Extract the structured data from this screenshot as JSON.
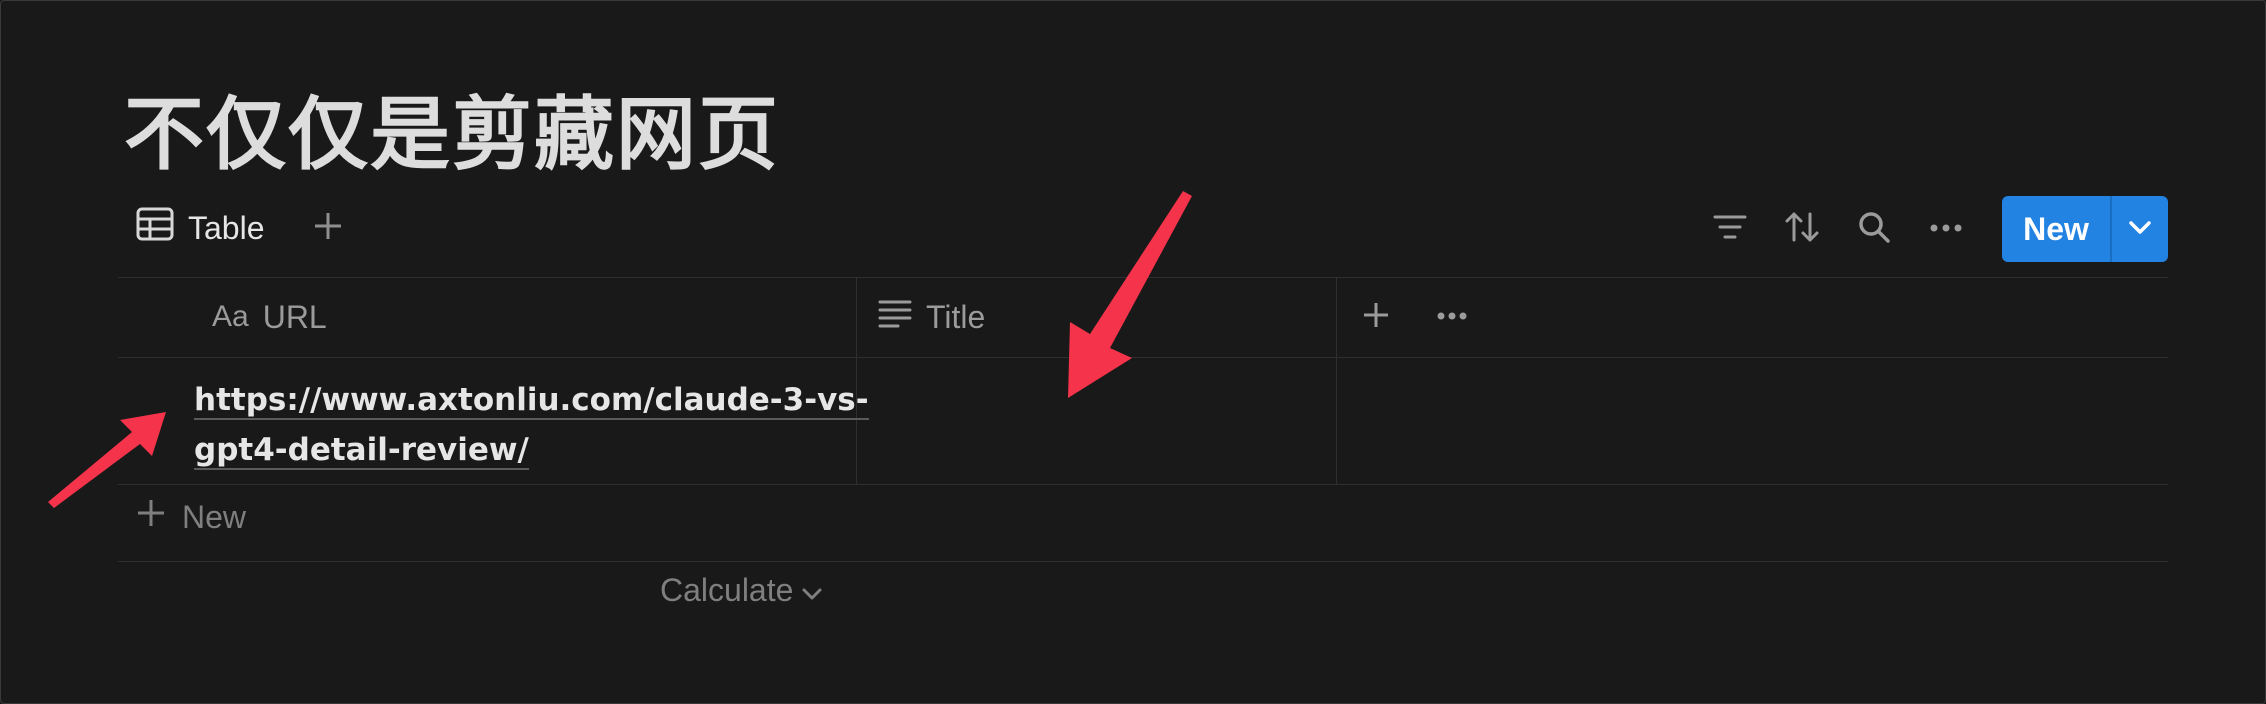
{
  "page": {
    "title": "不仅仅是剪藏网页"
  },
  "viewbar": {
    "active_view": {
      "icon": "table-icon",
      "label": "Table"
    },
    "add_view_icon": "plus-icon",
    "tools": [
      {
        "name": "filter-icon"
      },
      {
        "name": "sort-icon"
      },
      {
        "name": "search-icon"
      },
      {
        "name": "more-icon"
      }
    ],
    "new_button": {
      "label": "New",
      "dropdown_icon": "chevron-down-icon",
      "color": "#2383e2"
    }
  },
  "table": {
    "columns": [
      {
        "icon": "Aa",
        "label": "URL"
      },
      {
        "icon": "text-lines-icon",
        "label": "Title"
      }
    ],
    "rows": [
      {
        "url": "https://www.axtonliu.com/claude-3-vs-gpt4-detail-review/",
        "url_line1": "https://www.axtonliu.com/claude-3-vs-",
        "url_line2": "gpt4-detail-review/",
        "title": ""
      }
    ],
    "add_row_label": "New",
    "calculate_label": "Calculate"
  },
  "annotations": {
    "arrow_color": "#f5334a"
  }
}
